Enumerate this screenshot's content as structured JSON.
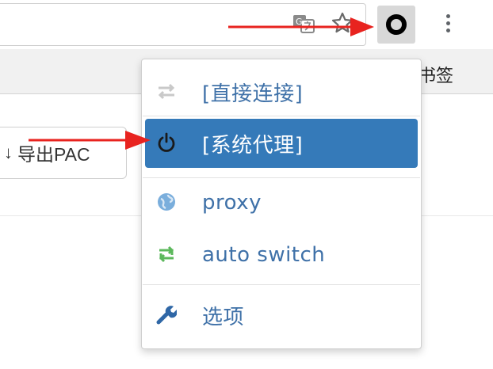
{
  "browser": {
    "bookmarks_bar_text": "书签",
    "icons": {
      "translate": "translate-icon",
      "bookmark_star": "star-icon",
      "extension": "switchyomega-ring-icon",
      "menu": "more-vert-icon"
    }
  },
  "page": {
    "export_button_label": "导出PAC",
    "export_button_glyph": "↓"
  },
  "popup": {
    "items": [
      {
        "label": "[直接连接]",
        "icon": "transfer-arrows-icon",
        "active": false
      },
      {
        "label": "[系统代理]",
        "icon": "power-icon",
        "active": true
      },
      {
        "label": "proxy",
        "icon": "globe-icon",
        "active": false
      },
      {
        "label": "auto switch",
        "icon": "auto-switch-icon",
        "active": false
      },
      {
        "label": "选项",
        "icon": "wrench-icon",
        "active": false
      }
    ]
  },
  "colors": {
    "active_bg": "#357ab9",
    "link_text": "#3f71a8",
    "arrow": "#e8231f",
    "globe": "#7aaedc",
    "auto_switch": "#5cb85c"
  }
}
